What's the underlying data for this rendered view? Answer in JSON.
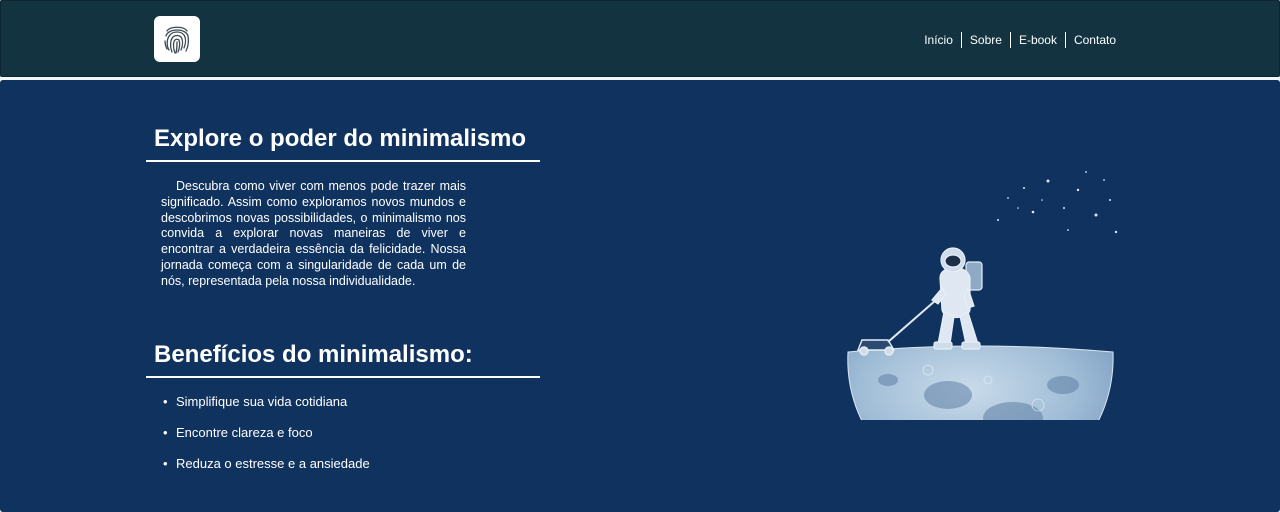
{
  "header": {
    "logo": {
      "icon": "fingerprint-icon"
    },
    "nav": [
      {
        "label": "Início"
      },
      {
        "label": "Sobre"
      },
      {
        "label": "E-book"
      },
      {
        "label": "Contato"
      }
    ]
  },
  "hero": {
    "title": "Explore o poder do minimalismo",
    "intro": "Descubra como viver com menos pode trazer mais significado. Assim como exploramos novos mundos e descobrimos novas possibilidades, o minimalismo nos convida a explorar novas maneiras de viver e encontrar a verdadeira essência da felicidade. Nossa jornada começa com a singularidade de cada um de nós, representada pela nossa individualidade.",
    "benefits_title": "Benefícios do minimalismo:",
    "benefits": [
      "Simplifique sua vida cotidiana",
      "Encontre clareza e foco",
      "Reduza o estresse e a ansiedade"
    ],
    "illustration": {
      "icon": "astronaut-mowing-moon-illustration"
    }
  },
  "colors": {
    "header_bg": "#12333f",
    "hero_bg": "#10325f",
    "text": "#ffffff",
    "moon": "#a9c3dc"
  }
}
